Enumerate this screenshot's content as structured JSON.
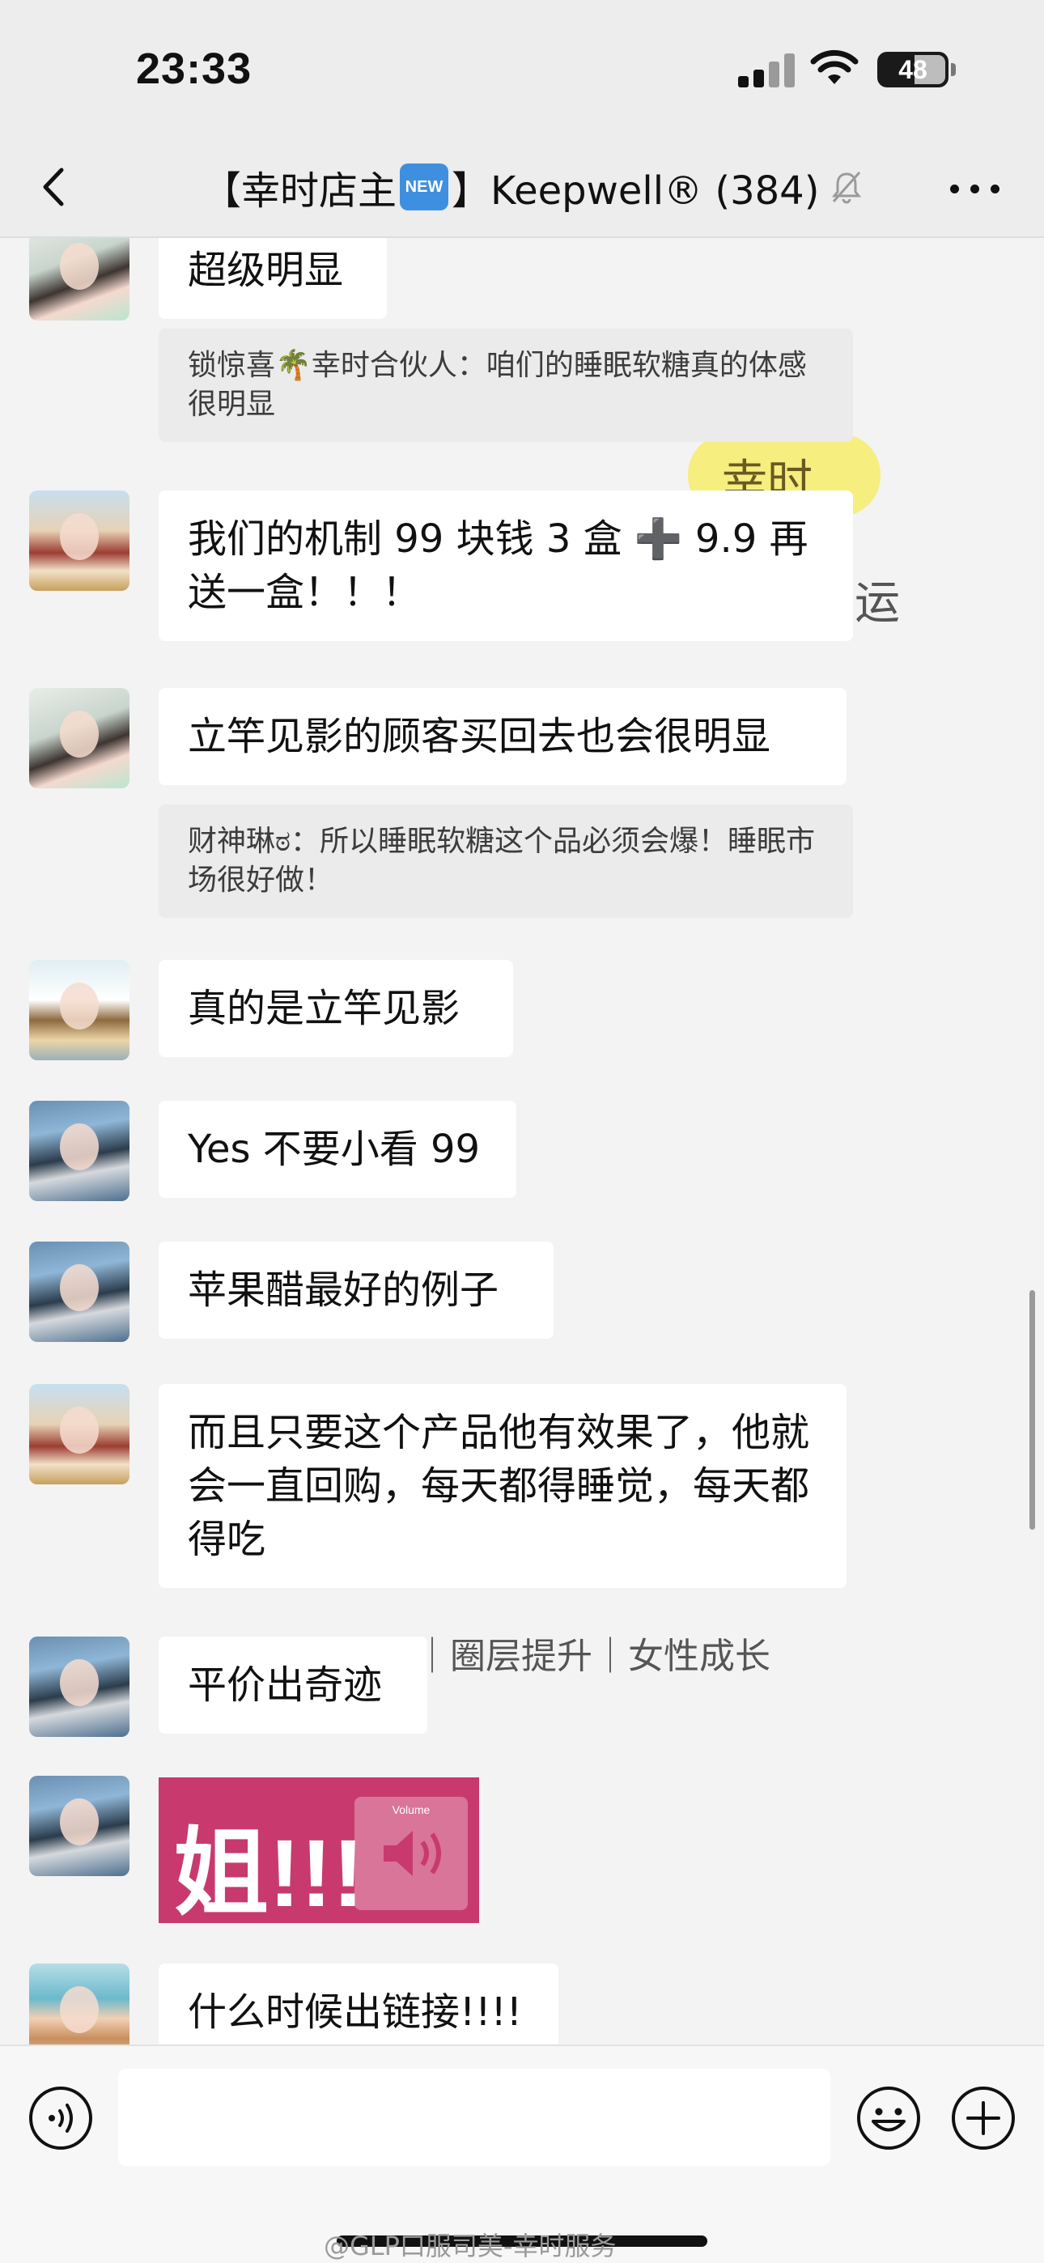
{
  "status_bar": {
    "time": "23:33",
    "battery": "48"
  },
  "nav": {
    "title_prefix": "【幸时店主",
    "new_badge": "NEW",
    "title_suffix": "】Keepwell® (384)"
  },
  "overlay": {
    "yellow_text": "幸时",
    "side_text": "运",
    "tagline": "｜圈层提升｜女性成长"
  },
  "messages": [
    {
      "text": "超级明显"
    },
    {
      "quote": "锁惊喜🌴幸时合伙人：咱们的睡眠软糖真的体感很明显"
    },
    {
      "text": "我们的机制 99 块钱 3 盒 ➕ 9.9 再送一盒！！！"
    },
    {
      "text": "立竿见影的顾客买回去也会很明显"
    },
    {
      "quote": "财神琳ಠ：所以睡眠软糖这个品必须会爆！睡眠市场很好做！"
    },
    {
      "text": "真的是立竿见影"
    },
    {
      "text": "Yes 不要小看 99"
    },
    {
      "text": "苹果醋最好的例子"
    },
    {
      "text": "而且只要这个产品他有效果了，他就会一直回购，每天都得睡觉，每天都得吃"
    },
    {
      "text": "平价出奇迹"
    },
    {
      "sticker_text": "姐!!!",
      "sticker_label": "Volume"
    },
    {
      "text": "什么时候出链接!!!!"
    }
  ],
  "input": {
    "placeholder": ""
  },
  "footer": {
    "watermark": "@GLP口服司美-幸时服务"
  }
}
